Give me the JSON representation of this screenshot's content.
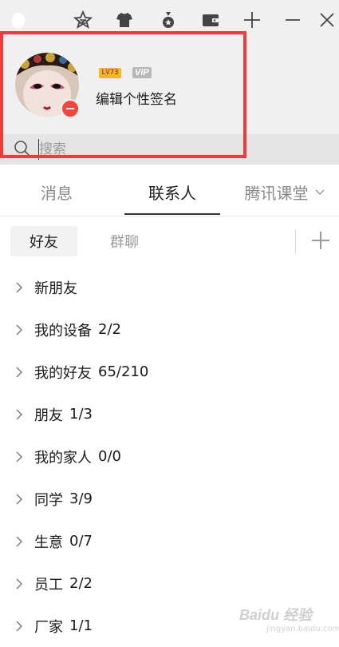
{
  "toolbar": {
    "icons": [
      "qzone-icon",
      "shirt-icon",
      "medal-icon",
      "wallet-icon",
      "plus-icon",
      "minimize-icon",
      "close-icon"
    ]
  },
  "profile": {
    "level_badge": "LV73",
    "vip_badge": "VIP",
    "signature": "编辑个性签名",
    "status": "busy"
  },
  "search": {
    "placeholder": "搜索"
  },
  "main_tabs": [
    {
      "label": "消息"
    },
    {
      "label": "联系人"
    },
    {
      "label": "腾讯课堂"
    }
  ],
  "sub_tabs": [
    {
      "label": "好友"
    },
    {
      "label": "群聊"
    }
  ],
  "groups": [
    {
      "label": "新朋友",
      "count": ""
    },
    {
      "label": "我的设备",
      "count": "2/2"
    },
    {
      "label": "我的好友",
      "count": "65/210"
    },
    {
      "label": "朋友",
      "count": "1/3"
    },
    {
      "label": "我的家人",
      "count": "0/0"
    },
    {
      "label": "同学",
      "count": "3/9"
    },
    {
      "label": "生意",
      "count": "0/7"
    },
    {
      "label": "员工",
      "count": "2/2"
    },
    {
      "label": "厂家",
      "count": "1/1"
    }
  ],
  "watermark": {
    "text": "Baidu 经验",
    "sub": "jingyan.baidu.com"
  },
  "colors": {
    "highlight": "#ee3b3b",
    "status_busy": "#f0463c",
    "level_badge": "#f4b626",
    "vip_badge": "#b9b9b9"
  }
}
